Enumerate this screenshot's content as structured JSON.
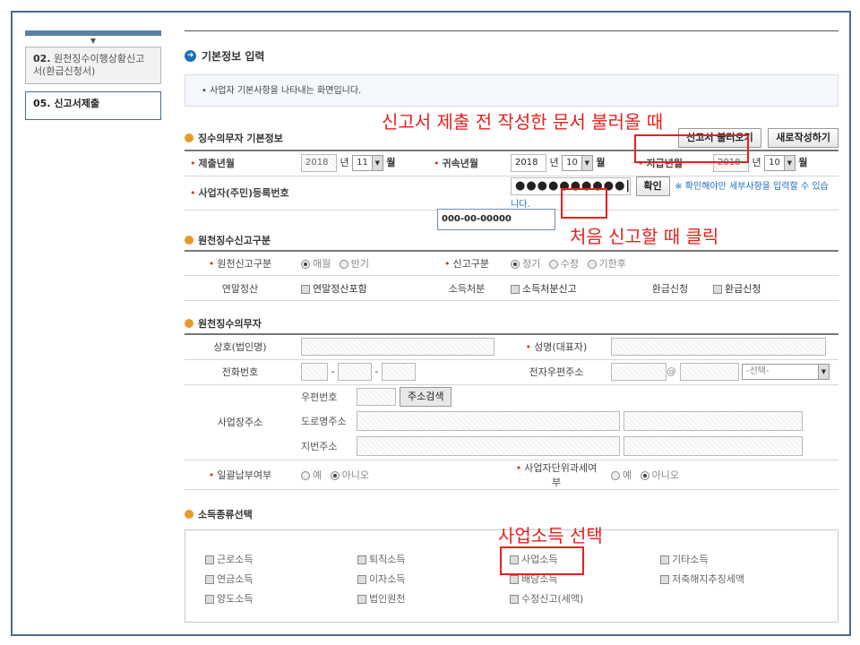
{
  "sidebar": {
    "items": [
      {
        "num": "02.",
        "label": "원천징수이행상황신고서(환급신청서)"
      },
      {
        "num": "05.",
        "label": "신고서제출"
      }
    ]
  },
  "page": {
    "title": "기본정보 입력",
    "info": "사업자 기본사항을 나타내는 화면입니다."
  },
  "section1": {
    "title": "징수의무자 기본정보",
    "btn_load": "신고서 불러오기",
    "btn_new": "새로작성하기",
    "submit_year_label": "제출년월",
    "submit_year": "2018",
    "year_unit": "년",
    "submit_month": "11",
    "month_unit": "월",
    "belong_label": "귀속년월",
    "belong_year": "2018",
    "belong_month": "10",
    "pay_label": "지급년월",
    "pay_year": "2018",
    "pay_month": "10",
    "reg_label": "사업자(주민)등록번호",
    "reg_value": "●●●●●●●●●●|",
    "confirm_btn": "확인",
    "notice": "※ 확인해야만 세부사항을 입력할 수 있습니다.",
    "reg_hint": "000-00-00000"
  },
  "section2": {
    "title": "원천징수신고구분",
    "type_label": "원천신고구분",
    "type_monthly": "매월",
    "type_half": "반기",
    "report_label": "신고구분",
    "report_regular": "정기",
    "report_amend": "수정",
    "report_late": "기한후",
    "annual_label": "연말정산",
    "annual_opt": "연말정산포함",
    "income_label": "소득처분",
    "income_opt": "소득처분신고",
    "refund_label": "환급신청",
    "refund_opt": "환급신청"
  },
  "section3": {
    "title": "원천징수의무자",
    "company_label": "상호(법인명)",
    "name_label": "성명(대표자)",
    "phone_label": "전화번호",
    "email_label": "전자우편주소",
    "email_at": "@",
    "email_select": "-선택-",
    "addr_label": "사업장주소",
    "zip_label": "우편번호",
    "addr_search": "주소검색",
    "road_label": "도로명주소",
    "lot_label": "지번주소",
    "bulk_label": "일괄납부여부",
    "unit_label": "사업자단위과세여부",
    "yes": "예",
    "no": "아니오",
    "dash": "-"
  },
  "section4": {
    "title": "소득종류선택",
    "items": [
      "근로소득",
      "퇴직소득",
      "사업소득",
      "기타소득",
      "연금소득",
      "이자소득",
      "배당소득",
      "저축해지추징세액",
      "양도소득",
      "법인원천",
      "수정신고(세액)"
    ]
  },
  "annotations": {
    "load_note": "신고서 제출 전 작성한 문서 불러올 때",
    "first_note": "처음 신고할 때 클릭",
    "biz_note": "사업소득 선택"
  },
  "colors": {
    "annotation": "#e8201c",
    "accent": "#1d6fb8",
    "bullet": "#e89a2a"
  }
}
